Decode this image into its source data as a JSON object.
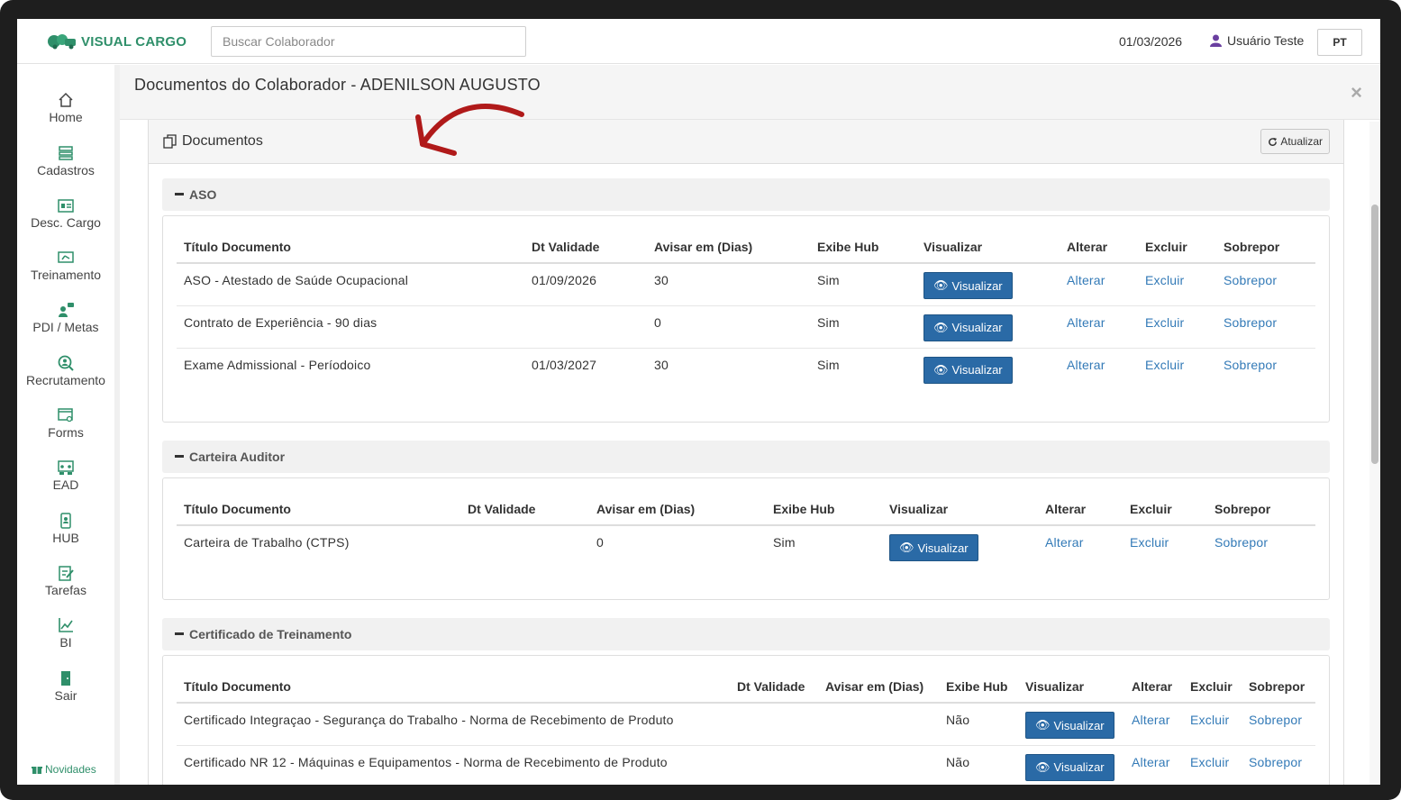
{
  "app": {
    "brand": "VISUAL CARGO",
    "search_placeholder": "Buscar Colaborador",
    "date": "01/03/2026",
    "user": "Usuário Teste",
    "language": "PT"
  },
  "sidebar": {
    "items": [
      {
        "label": "Home",
        "icon": "home-icon"
      },
      {
        "label": "Cadastros",
        "icon": "list-icon"
      },
      {
        "label": "Desc. Cargo",
        "icon": "id-card-icon"
      },
      {
        "label": "Treinamento",
        "icon": "training-icon"
      },
      {
        "label": "PDI / Metas",
        "icon": "goals-icon"
      },
      {
        "label": "Recrutamento",
        "icon": "recruit-icon"
      },
      {
        "label": "Forms",
        "icon": "forms-icon"
      },
      {
        "label": "EAD",
        "icon": "ead-icon"
      },
      {
        "label": "HUB",
        "icon": "hub-icon"
      },
      {
        "label": "Tarefas",
        "icon": "tasks-icon"
      },
      {
        "label": "BI",
        "icon": "chart-icon"
      },
      {
        "label": "Sair",
        "icon": "exit-icon"
      }
    ],
    "news_label": "Novidades"
  },
  "modal": {
    "title": "Documentos do Colaborador - ADENILSON AUGUSTO",
    "close": "×"
  },
  "panel": {
    "title": "Documentos",
    "refresh_label": "Atualizar"
  },
  "columns": {
    "title": "Título Documento",
    "validity": "Dt Validade",
    "notify": "Avisar em (Dias)",
    "hub": "Exibe Hub",
    "view": "Visualizar",
    "edit": "Alterar",
    "delete": "Excluir",
    "overlay": "Sobrepor"
  },
  "actions": {
    "view": "Visualizar",
    "edit": "Alterar",
    "delete": "Excluir",
    "overlay": "Sobrepor"
  },
  "sections": [
    {
      "name": "ASO",
      "rows": [
        {
          "title": "ASO - Atestado de Saúde Ocupacional",
          "validity": "01/09/2026",
          "notify": "30",
          "hub": "Sim"
        },
        {
          "title": "Contrato de Experiência - 90 dias",
          "validity": "",
          "notify": "0",
          "hub": "Sim"
        },
        {
          "title": "Exame Admissional - Períodoico",
          "validity": "01/03/2027",
          "notify": "30",
          "hub": "Sim"
        }
      ]
    },
    {
      "name": "Carteira Auditor",
      "rows": [
        {
          "title": "Carteira de Trabalho (CTPS)",
          "validity": "",
          "notify": "0",
          "hub": "Sim"
        }
      ]
    },
    {
      "name": "Certificado de Treinamento",
      "rows": [
        {
          "title": "Certificado Integraçao - Segurança do Trabalho - Norma de Recebimento de Produto",
          "validity": "",
          "notify": "",
          "hub": "Não"
        },
        {
          "title": "Certificado NR 12 - Máquinas e Equipamentos - Norma de Recebimento de Produto",
          "validity": "",
          "notify": "",
          "hub": "Não"
        }
      ]
    }
  ],
  "colors": {
    "brand": "#2f8f6a",
    "button": "#2a6aa6",
    "link": "#337ab7",
    "annotation": "#b01a1a"
  }
}
